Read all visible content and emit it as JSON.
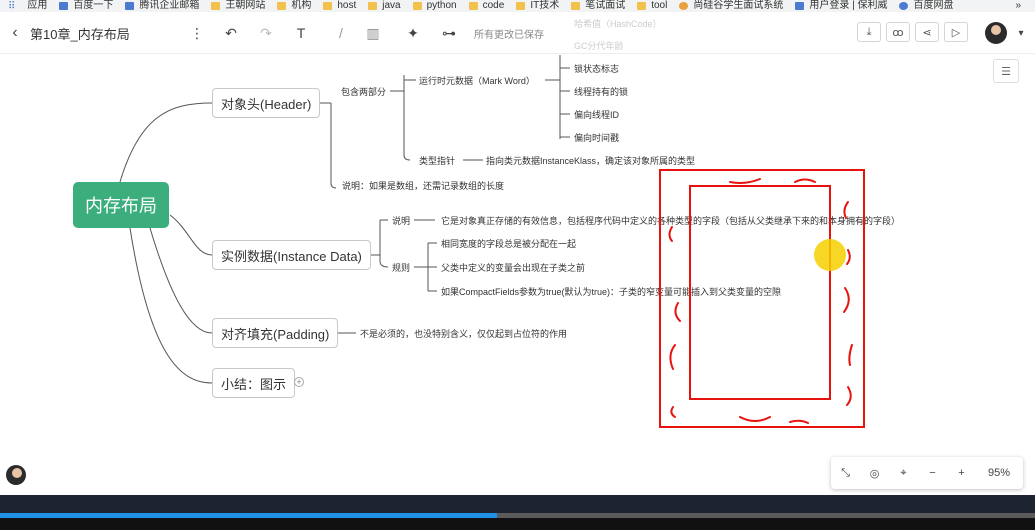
{
  "bookmarks": [
    "应用",
    "百度一下",
    "腾讯企业邮箱",
    "王朝网站",
    "机构",
    "host",
    "java",
    "python",
    "code",
    "IT技术",
    "笔试面试",
    "tool",
    "尚硅谷学生面试系统",
    "用户登录 | 保利威",
    "百度网盘"
  ],
  "toolbar": {
    "title": "第10章_内存布局",
    "save_status": "所有更改已保存",
    "back_icon": "chevron-left-icon",
    "more_icon": "more-vertical-icon"
  },
  "mindmap": {
    "root": "内存布局",
    "header": {
      "label": "对象头(Header)",
      "includes": "包含两部分",
      "mark_word": "运行时元数据（Mark Word）",
      "mark_items": [
        "哈希值（HashCode）",
        "GC分代年龄",
        "锁状态标志",
        "线程持有的锁",
        "偏向线程ID",
        "偏向时间戳"
      ],
      "klass": "类型指针",
      "klass_desc": "指向类元数据InstanceKlass，确定该对象所属的类型",
      "array_note": "说明：如果是数组，还需记录数组的长度"
    },
    "instance": {
      "label": "实例数据(Instance Data)",
      "desc_key": "说明",
      "desc": "它是对象真正存储的有效信息，包括程序代码中定义的各种类型的字段（包括从父类继承下来的和本身拥有的字段）",
      "rules_key": "规则",
      "rules": [
        "相同宽度的字段总是被分配在一起",
        "父类中定义的变量会出现在子类之前",
        "如果CompactFields参数为true(默认为true)：子类的窄变量可能插入到父类变量的空隙"
      ]
    },
    "padding": {
      "label": "对齐填充(Padding)",
      "desc": "不是必须的，也没特别含义，仅仅起到占位符的作用"
    },
    "summary": {
      "label": "小结：图示"
    }
  },
  "zoom": {
    "value": "95%",
    "minus": "−",
    "plus": "+"
  },
  "video": {
    "progress": 0.48
  },
  "colors": {
    "root": "#3cae7e",
    "annotation": "#e8130e",
    "cursor": "#f5d000"
  }
}
